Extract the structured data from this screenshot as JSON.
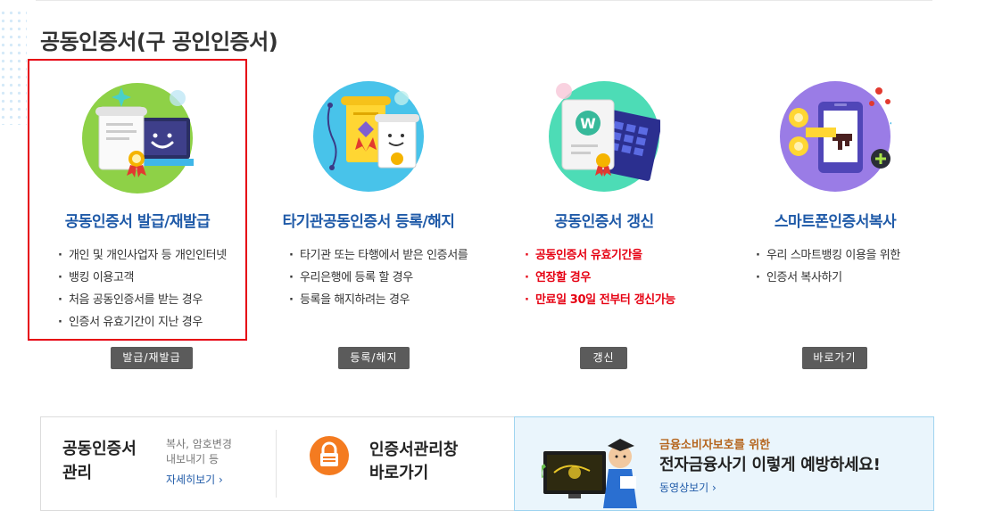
{
  "page": {
    "title": "공동인증서(구 공인인증서)"
  },
  "cards": [
    {
      "title": "공동인증서 발급/재발급",
      "bullets": [
        "개인 및 개인사업자 등 개인인터넷",
        "뱅킹 이용고객",
        "처음 공동인증서를 받는 경우",
        "인증서 유효기간이 지난 경우"
      ],
      "button": "발급/재발급",
      "icon": "certificate-laptop-icon",
      "highlight_color": "#e60012"
    },
    {
      "title": "타기관공동인증서 등록/해지",
      "bullets": [
        "타기관 또는 타행에서 받은 인증서를",
        "우리은행에 등록 할 경우",
        "등록을 해지하려는 경우"
      ],
      "button": "등록/해지",
      "icon": "certificate-scroll-icon"
    },
    {
      "title": "공동인증서 갱신",
      "bullets": [
        "공동인증서 유효기간을",
        "연장할 경우",
        "만료일 30일 전부터 갱신가능"
      ],
      "button": "갱신",
      "icon": "certificate-calendar-icon"
    },
    {
      "title": "스마트폰인증서복사",
      "bullets": [
        "우리 스마트뱅킹 이용을 위한",
        "인증서 복사하기"
      ],
      "button": "바로가기",
      "icon": "smartphone-key-icon"
    }
  ],
  "bottom": {
    "manage": {
      "title_line1": "공동인증서",
      "title_line2": "관리",
      "sub_line1": "복사, 암호변경",
      "sub_line2": "내보내기 등",
      "link": "자세히보기 ›"
    },
    "window": {
      "title_line1": "인증서관리창",
      "title_line2": "바로가기",
      "icon": "lock-icon"
    },
    "promo": {
      "subtitle": "금융소비자보호를 위한",
      "title": "전자금융사기 이렇게 예방하세요!",
      "link": "동영상보기 ›"
    }
  },
  "colors": {
    "accent_blue": "#1f5aa8",
    "alert_red": "#e60012",
    "button_gray": "#5b5b5b",
    "promo_bg": "#eaf5fc"
  }
}
